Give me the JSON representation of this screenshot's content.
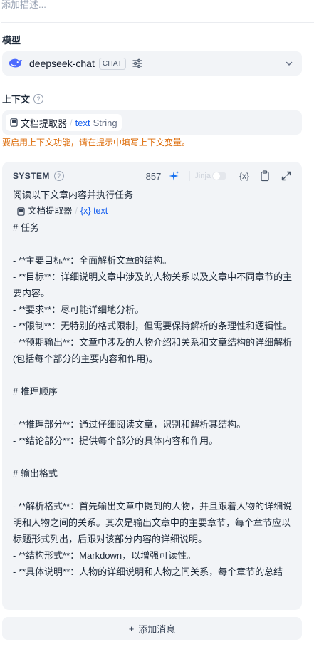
{
  "description": {
    "placeholder": "添加描述..."
  },
  "model_section": {
    "title": "模型",
    "model_name": "deepseek-chat",
    "mode_badge": "CHAT",
    "icons": [
      "deepseek-logo-icon",
      "settings-sliders-icon",
      "chevron-down-icon"
    ]
  },
  "context_section": {
    "title": "上下文",
    "help": "?",
    "variable": {
      "node": "文档提取器",
      "separator": "/",
      "name": "text",
      "type": "String"
    },
    "warning": "要启用上下文功能，请在提示中填写上下文变量。"
  },
  "system_prompt": {
    "role": "SYSTEM",
    "help": "?",
    "token_count": "857",
    "jinja_label": "Jinja",
    "jinja_enabled": false,
    "var_insert_label": "{x}",
    "intro": "阅读以下文章内容并执行任务",
    "inline_var": {
      "node": "文档提取器",
      "separator": "/",
      "name": "{x} text"
    },
    "lines": [
      "# 任务",
      "",
      "- **主要目标**：全面解析文章的结构。",
      "- **目标**：详细说明文章中涉及的人物关系以及文章中不同章节的主要内容。",
      "- **要求**：尽可能详细地分析。",
      "- **限制**：无特别的格式限制，但需要保持解析的条理性和逻辑性。",
      "- **预期输出**：文章中涉及的人物介绍和关系和文章结构的详细解析(包括每个部分的主要内容和作用)。",
      "",
      "# 推理顺序",
      "",
      "- **推理部分**：通过仔细阅读文章，识别和解析其结构。",
      "- **结论部分**：提供每个部分的具体内容和作用。",
      "",
      "# 输出格式",
      "",
      "- **解析格式**：首先输出文章中提到的人物，并且跟着人物的详细说明和人物之间的关系。其次是输出文章中的主要章节，每个章节应以标题形式列出，后跟对该部分内容的详细说明。",
      "- **结构形式**：Markdown，以增强可读性。",
      "- **具体说明**：人物的详细说明和人物之间关系，每个章节的总结"
    ]
  },
  "add_message": {
    "icon": "+",
    "label": "添加消息"
  },
  "colors": {
    "accent": "#155eef",
    "warning": "#dc6803",
    "panel": "#f2f4f7",
    "sparkle": "#1570ef"
  }
}
